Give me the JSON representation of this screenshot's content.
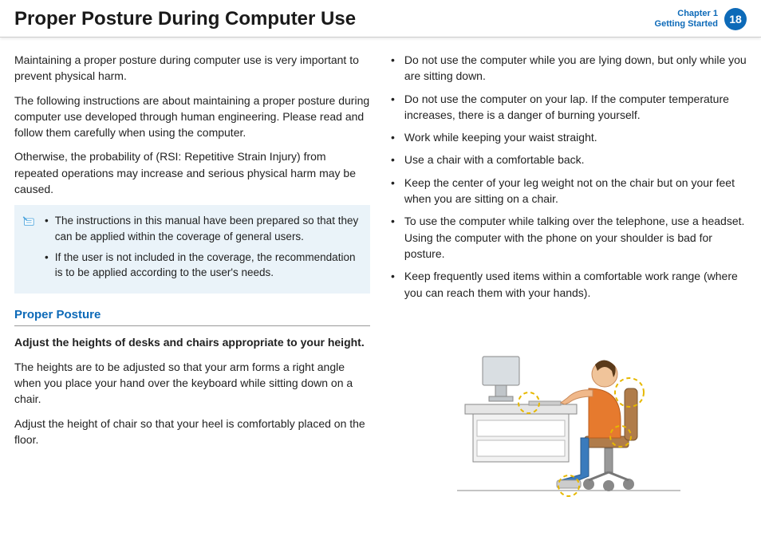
{
  "header": {
    "title": "Proper Posture During Computer Use",
    "chapter_line1": "Chapter 1",
    "chapter_line2": "Getting Started",
    "page_number": "18"
  },
  "left": {
    "p1": "Maintaining a proper posture during computer use is very important to prevent physical harm.",
    "p2": "The following instructions are about maintaining a proper posture during computer use developed through human engineering. Please read and follow them carefully when using the computer.",
    "p3": "Otherwise, the probability of (RSI: Repetitive Strain Injury) from repeated operations may increase and serious physical harm may be caused.",
    "note1": "The instructions in this manual have been prepared so that they can be applied within the coverage of general users.",
    "note2": "If the user is not included in the coverage, the recommendation is to be applied according to the user's needs.",
    "section_title": "Proper Posture",
    "sub_bold": "Adjust the heights of desks and chairs appropriate to your height.",
    "p4": "The heights are to be adjusted so that your arm forms a right angle when you place your hand over the keyboard while sitting down on a chair.",
    "p5": "Adjust the height of chair so that your heel is comfortably placed on the floor."
  },
  "right": {
    "b1": "Do not use the computer while you are lying down, but only while you are sitting down.",
    "b2": "Do not use the computer on your lap. If the computer temperature increases, there is a danger of burning yourself.",
    "b3": "Work while keeping your waist straight.",
    "b4": "Use a chair with a comfortable back.",
    "b5": "Keep the center of your leg weight not on the chair but on your feet when you are sitting on a chair.",
    "b6": "To use the computer while talking over the telephone, use a headset. Using the computer with the phone on your shoulder is bad for posture.",
    "b7": "Keep frequently used items within a comfortable work range (where you can reach them with your hands)."
  }
}
